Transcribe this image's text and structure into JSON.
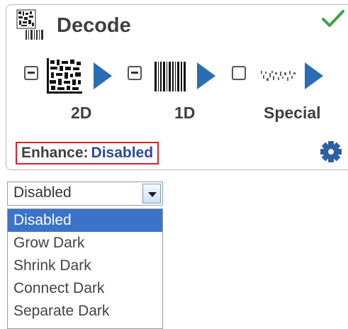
{
  "panel": {
    "title": "Decode",
    "status_icon": "check-icon",
    "status_color": "#3aa34a",
    "symbologies": [
      {
        "label": "2D",
        "state": "indeterminate",
        "icon": "datamatrix-icon"
      },
      {
        "label": "1D",
        "state": "indeterminate",
        "icon": "barcode-icon"
      },
      {
        "label": "Special",
        "state": "unchecked",
        "icon": "special-code-icon"
      }
    ],
    "enhance": {
      "label": "Enhance:",
      "value": "Disabled",
      "highlight_color": "#d9232b",
      "value_color": "#2e4b9a"
    },
    "settings_icon": "gear-icon"
  },
  "dropdown": {
    "selected_value": "Disabled",
    "options": [
      "Disabled",
      "Grow Dark",
      "Shrink Dark",
      "Connect Dark",
      "Separate Dark"
    ],
    "highlighted_option": "Disabled",
    "accent": "#3b73c8"
  }
}
